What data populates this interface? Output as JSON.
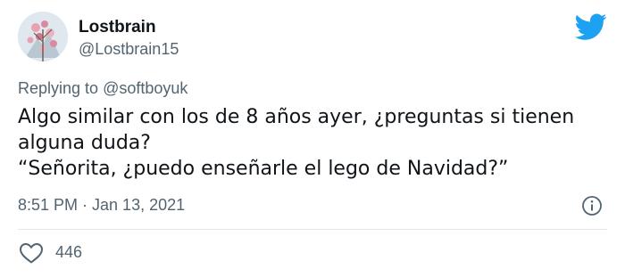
{
  "tweet": {
    "display_name": "Lostbrain",
    "handle": "@Lostbrain15",
    "replying_prefix": "Replying to ",
    "replying_to": "@softboyuk",
    "text_lines": [
      "Algo similar con los de 8 años ayer, ¿preguntas si tienen",
      "alguna duda?",
      "“Señorita, ¿puedo enseñarle el lego de Navidad?”"
    ],
    "timestamp": "8:51 PM · Jan 13, 2021",
    "like_count": "446"
  },
  "icons": {
    "brand": "twitter-bird-icon",
    "info": "info-icon",
    "like": "heart-icon"
  },
  "colors": {
    "brand_blue": "#1da1f2",
    "secondary_text": "#536471",
    "primary_text": "#0f1419",
    "divider": "#e1e8ed"
  }
}
